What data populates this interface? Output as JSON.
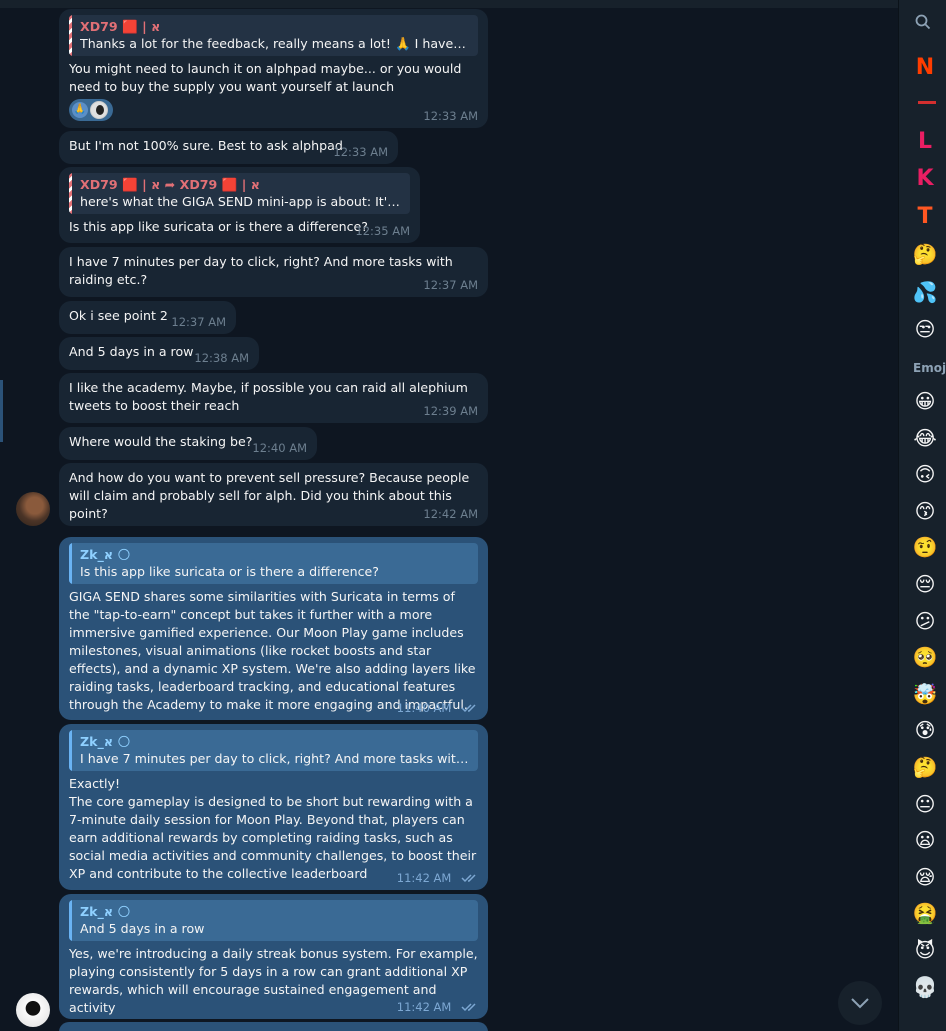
{
  "messages": [
    {
      "reply_name": "XD79 🟥 | א",
      "reply_text": "Thanks a lot for the feedback, really means a lot! 🙏 I haven't hit...",
      "text": "You might need to launch it on alphpad maybe... or you would need to buy the supply you want yourself at launch",
      "time": "12:33 AM",
      "reaction": "🙏"
    },
    {
      "text": "But I'm not 100% sure. Best to ask alphpad",
      "time": "12:33 AM"
    },
    {
      "reply_name": "XD79 🟥 | א ➦ XD79 🟥 | א",
      "reply_text": "here's what the GIGA SEND mini-app is about: It's a g...",
      "text": "Is this app like suricata or is there a difference?",
      "time": "12:35 AM"
    },
    {
      "text": "I have 7 minutes per day to click, right? And more tasks with raiding etc.?",
      "time": "12:37 AM"
    },
    {
      "text": "Ok i see point 2",
      "time": "12:37 AM"
    },
    {
      "text": "And 5 days in a row",
      "time": "12:38 AM"
    },
    {
      "text": "I like the academy. Maybe, if possible you can raid all alephium tweets to boost their reach",
      "time": "12:39 AM"
    },
    {
      "text": "Where would the staking be?",
      "time": "12:40 AM"
    },
    {
      "text": "And how do you want to prevent sell pressure? Because people will claim and probably sell for alph. Did you think about this point?",
      "time": "12:42 AM"
    },
    {
      "reply_name": "Zk_א 🌕",
      "reply_text": "Is this app like suricata or is there a difference?",
      "text": "GIGA SEND shares some similarities with Suricata in terms of the \"tap-to-earn\" concept but takes it further with a more immersive gamified experience. Our Moon Play game includes milestones, visual animations (like rocket boosts and star effects), and a dynamic XP system. We're also adding layers like raiding tasks, leaderboard tracking, and educational features through the Academy to make it more engaging and impactful.",
      "time": "11:40 AM"
    },
    {
      "reply_name": "Zk_א 🌕",
      "reply_text": "I have 7 minutes per day to click, right? And more tasks with raid...",
      "text": "Exactly!\nThe core gameplay is designed to be short but rewarding with a 7-minute daily session for Moon Play. Beyond that, players can earn additional rewards by completing raiding tasks, such as social media activities and community challenges, to boost their XP and contribute to the collective leaderboard",
      "time": "11:42 AM"
    },
    {
      "reply_name": "Zk_א 🌕",
      "reply_text": "And 5 days in a row",
      "text": "Yes, we're introducing a daily streak bonus system. For example, playing consistently for 5 days in a row can grant additional XP rewards, which will encourage sustained engagement and activity",
      "time": "11:42 AM"
    }
  ],
  "panel": {
    "packs": [
      {
        "glyph": "N",
        "color": "#ff3d00"
      },
      {
        "glyph": "L",
        "color": "#e91e63"
      },
      {
        "glyph": "K",
        "color": "#e91e63"
      },
      {
        "glyph": "T",
        "color": "#ff5722"
      }
    ],
    "pack_emojis": [
      "🤔",
      "💦",
      "😒"
    ],
    "section_label": "Emoji",
    "emojis": [
      "😀",
      "😂",
      "🙃",
      "😙",
      "🤨",
      "😔",
      "😕",
      "🥺",
      "🤯",
      "😰",
      "🤔",
      "😐",
      "😦",
      "😪",
      "🤮",
      "😈",
      "💀"
    ]
  },
  "colors": {
    "background": "#0e1621",
    "incoming": "#182533",
    "outgoing": "#2b5278",
    "accent": "#6ab3f3",
    "reply_name": "#e17076"
  }
}
